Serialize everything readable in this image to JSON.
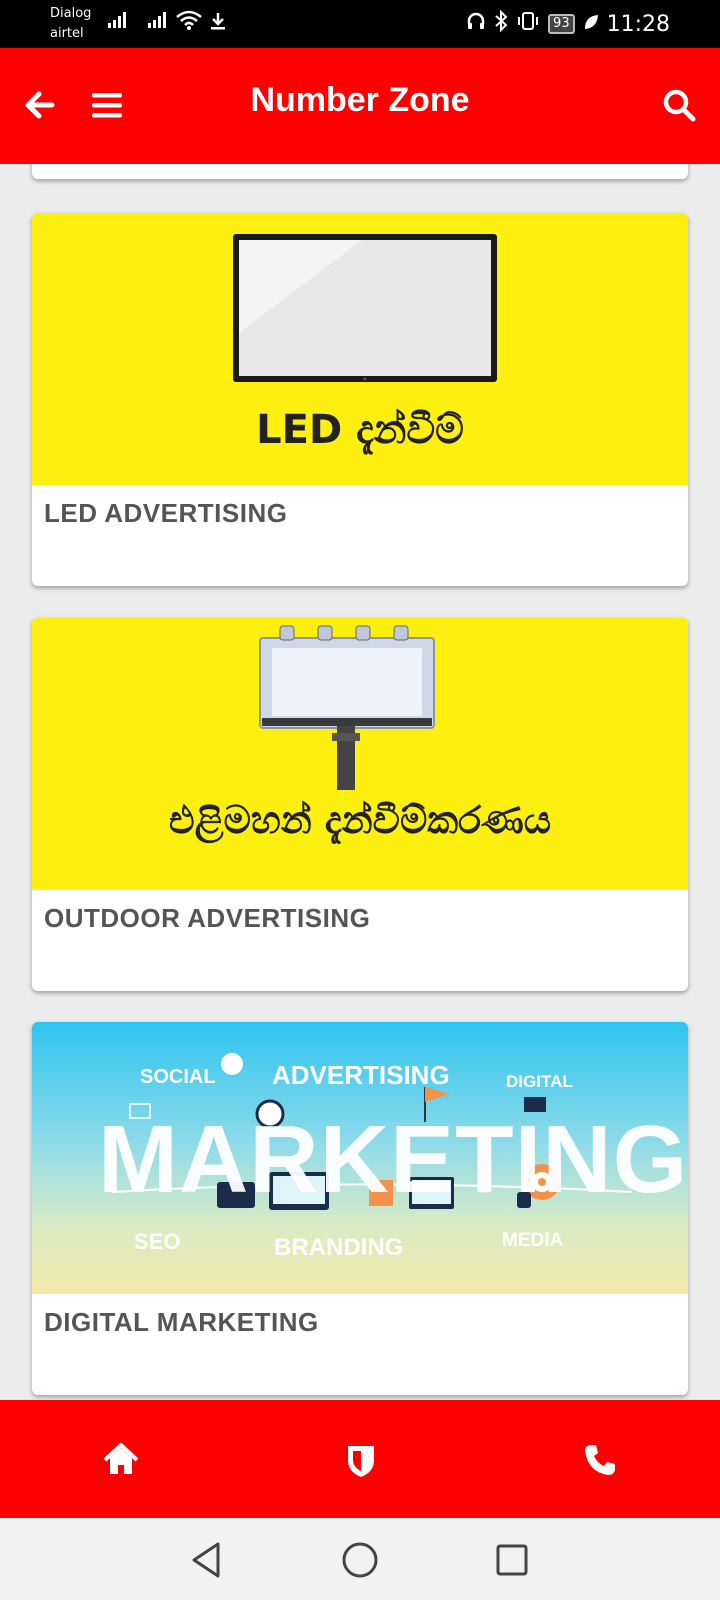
{
  "status_bar": {
    "carrier_line1": "Dialog",
    "carrier_line2": "airtel",
    "battery": "93",
    "time": "11:28"
  },
  "app_bar": {
    "title": "Number Zone",
    "icons": [
      "back-arrow-icon",
      "menu-icon",
      "search-icon"
    ]
  },
  "cards": [
    {
      "title": "LED ADVERTISING",
      "image_caption": "LED දැන්වීම්"
    },
    {
      "title": "OUTDOOR ADVERTISING",
      "image_caption": "එළිමහන් දැන්වීම්කරණය"
    },
    {
      "title": "DIGITAL MARKETING",
      "image_words": {
        "social": "SOCIAL",
        "advertising": "ADVERTISING",
        "digital": "DIGITAL",
        "marketing": "MARKETING",
        "seo": "SEO",
        "branding": "BRANDING",
        "media": "MEDIA"
      }
    }
  ],
  "bottom_nav": [
    "home-icon",
    "shield-icon",
    "phone-icon"
  ],
  "system_nav": [
    "back-triangle-icon",
    "home-circle-icon",
    "recents-square-icon"
  ],
  "colors": {
    "brand_red": "#fe0000",
    "card_yellow": "#fdf010",
    "title_gray": "#555555"
  }
}
